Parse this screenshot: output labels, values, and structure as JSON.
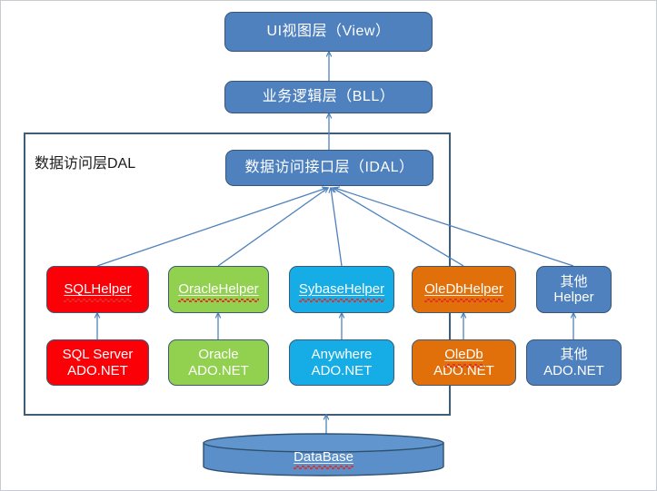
{
  "diagram": {
    "title_layers": [
      {
        "id": "view",
        "label": "UI视图层（View）"
      },
      {
        "id": "bll",
        "label": "业务逻辑层（BLL）"
      },
      {
        "id": "idal",
        "label": "数据访问接口层（IDAL）"
      }
    ],
    "dal_container_label": "数据访问层DAL",
    "helpers": [
      {
        "id": "sql-helper",
        "label": "SQLHelper",
        "color": "#fb0007",
        "spellchecked": true,
        "line1": "SQLHelper",
        "line2": ""
      },
      {
        "id": "oracle-helper",
        "label": "OracleHelper",
        "color": "#92d050",
        "spellchecked": true,
        "line1": "OracleHelper",
        "line2": ""
      },
      {
        "id": "sybase-helper",
        "label": "SybaseHelper",
        "color": "#16ace5",
        "spellchecked": true,
        "line1": "SybaseHelper",
        "line2": ""
      },
      {
        "id": "oledb-helper",
        "label": "OleDbHelper",
        "color": "#e2700a",
        "spellchecked": true,
        "line1": "OleDbHelper",
        "line2": ""
      },
      {
        "id": "other-helper",
        "label": "其他 Helper",
        "color": "#4e81bd",
        "spellchecked": false,
        "line1": "其他",
        "line2": "Helper"
      }
    ],
    "providers": [
      {
        "id": "sqlserver-ado",
        "color": "#fb0007",
        "line1": "SQL Server",
        "line2": "ADO.NET",
        "spellchecked": false
      },
      {
        "id": "oracle-ado",
        "color": "#92d050",
        "line1": "Oracle",
        "line2": "ADO.NET",
        "spellchecked": false
      },
      {
        "id": "anywhere-ado",
        "color": "#16ace5",
        "line1": "Anywhere",
        "line2": "ADO.NET",
        "spellchecked": false
      },
      {
        "id": "oledb-ado",
        "color": "#e2700a",
        "line1": "OleDb",
        "line2": "ADO.NET",
        "spellchecked": true
      },
      {
        "id": "other-ado",
        "color": "#4e81bd",
        "line1": "其他",
        "line2": "ADO.NET",
        "spellchecked": false
      }
    ],
    "database": {
      "label": "DataBase",
      "spellchecked": true
    },
    "colors": {
      "blue": "#4e81bd",
      "red": "#fb0007",
      "green": "#92d050",
      "cyan": "#16ace5",
      "orange": "#e2700a",
      "connector": "#4e81bd",
      "container_border": "#3f5d77",
      "page_border": "#c8ccd2",
      "spell_underline": "#e03028"
    }
  }
}
